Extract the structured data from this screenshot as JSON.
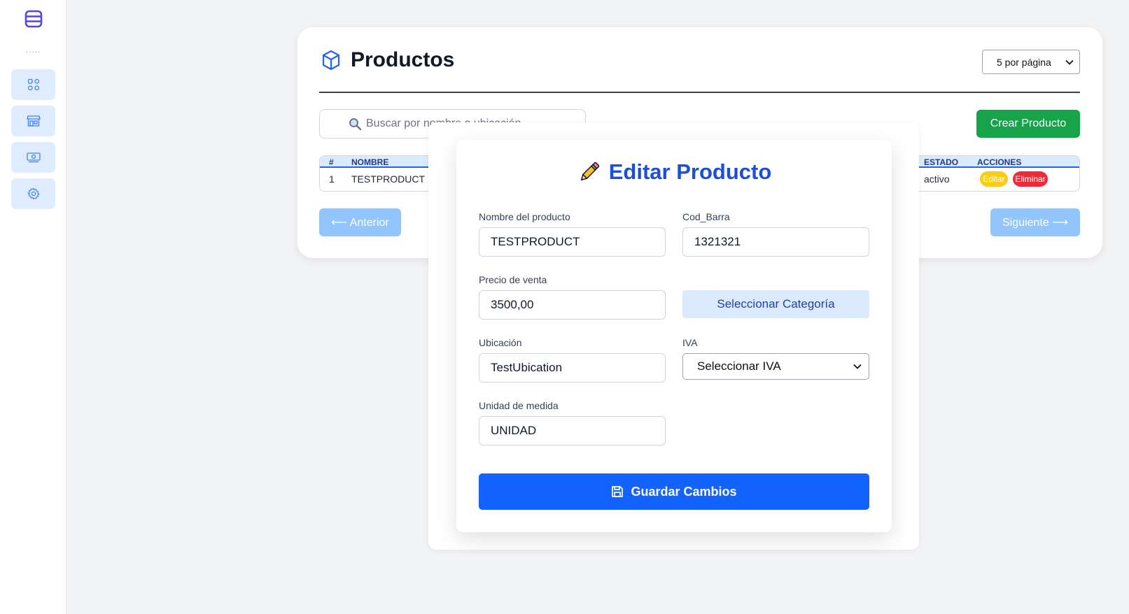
{
  "sidebar": {
    "dots": ".....",
    "items": [
      {
        "icon": "grid-icon"
      },
      {
        "icon": "store-icon"
      },
      {
        "icon": "money-icon"
      },
      {
        "icon": "gear-icon"
      }
    ]
  },
  "products": {
    "title": "Productos",
    "per_page": "5 por página",
    "search_placeholder": "Buscar por nombre o ubicación",
    "create_label": "Crear Producto",
    "table": {
      "headers": {
        "num": "#",
        "name": "NOMBRE",
        "status": "ESTADO",
        "actions": "ACCIONES"
      },
      "rows": [
        {
          "num": "1",
          "name": "TESTPRODUCT",
          "partial": ")",
          "status": "activo",
          "edit": "Editar",
          "delete": "Eliminar"
        }
      ]
    },
    "prev_label": "⟵ Anterior",
    "next_label": "Siguiente ⟶"
  },
  "modal": {
    "title": "Editar Producto",
    "fields": {
      "nombre": {
        "label": "Nombre del producto",
        "value": "TESTPRODUCT"
      },
      "cod_barra": {
        "label": "Cod_Barra",
        "value": "1321321"
      },
      "precio": {
        "label": "Precio de venta",
        "value": "3500,00"
      },
      "categoria": {
        "button": "Seleccionar Categoría"
      },
      "ubicacion": {
        "label": "Ubicación",
        "value": "TestUbication"
      },
      "iva": {
        "label": "IVA",
        "selected": "Seleccionar IVA"
      },
      "unidad": {
        "label": "Unidad de medida",
        "value": "UNIDAD"
      }
    },
    "save_label": "Guardar Cambios"
  },
  "colors": {
    "primary": "#1563ff",
    "title_blue": "#1d4ed8",
    "success": "#16a34a",
    "warning": "#facc15",
    "danger": "#ef2b3a",
    "disabled_blue": "#93c5fd"
  }
}
